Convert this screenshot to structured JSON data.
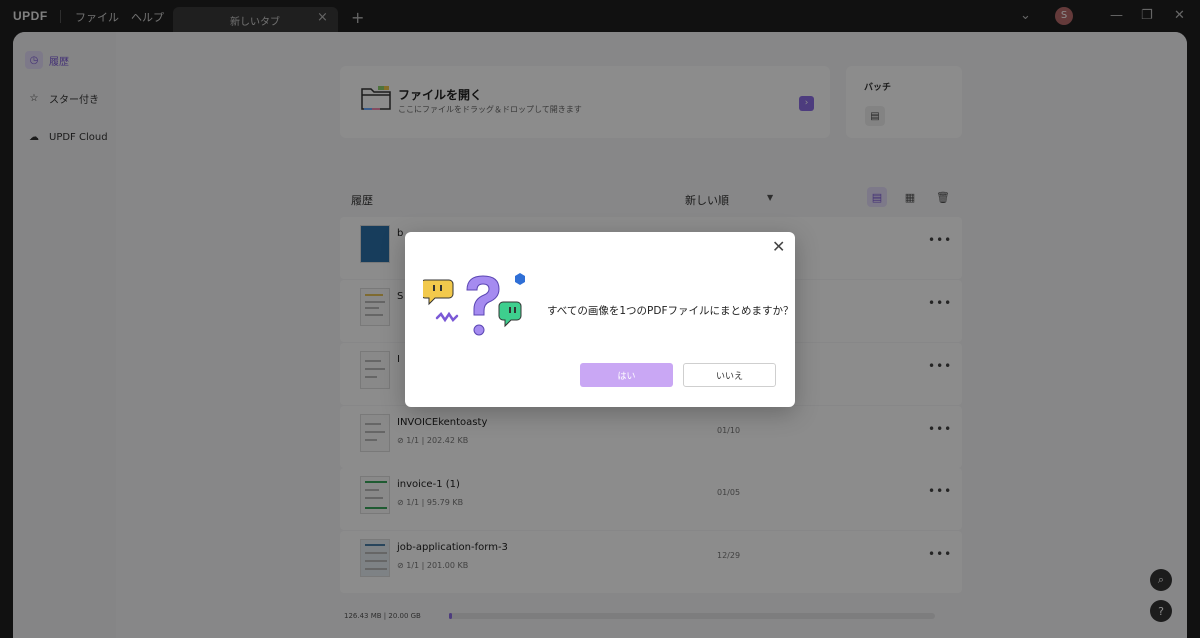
{
  "titlebar": {
    "logo": "UPDF",
    "menu": [
      "ファイル",
      "ヘルプ"
    ],
    "tab_label": "新しいタブ",
    "avatar_initial": "S"
  },
  "sidebar": {
    "items": [
      {
        "label": "履歴",
        "icon": "clock-icon",
        "active": true
      },
      {
        "label": "スター付き",
        "icon": "star-icon",
        "active": false
      },
      {
        "label": "UPDF Cloud",
        "icon": "cloud-icon",
        "active": false
      }
    ]
  },
  "open_card": {
    "title": "ファイルを開く",
    "subtitle": "ここにファイルをドラッグ＆ドロップして開きます"
  },
  "batch_card": {
    "title": "バッチ"
  },
  "history": {
    "title": "履歴",
    "sort_label": "新しい順",
    "files": [
      {
        "name": "b",
        "pages": "",
        "size": "",
        "date": ""
      },
      {
        "name": "S",
        "pages": "",
        "size": "",
        "date": ""
      },
      {
        "name": "I",
        "pages": "",
        "size": "",
        "date": ""
      },
      {
        "name": "INVOICEkentoasty",
        "pages": "1/1",
        "size": "202.42 KB",
        "date": "01/10"
      },
      {
        "name": "invoice-1 (1)",
        "pages": "1/1",
        "size": "95.79 KB",
        "date": "01/05"
      },
      {
        "name": "job-application-form-3",
        "pages": "1/1",
        "size": "201.00 KB",
        "date": "12/29"
      }
    ]
  },
  "storage": {
    "text": "126.43 MB | 20.00 GB",
    "used_fraction": 0.006
  },
  "dialog": {
    "message": "すべての画像を1つのPDFファイルにまとめますか？",
    "yes_label": "はい",
    "no_label": "いいえ"
  },
  "colors": {
    "accent": "#8d6ee6",
    "yes_button": "#c9a7f4"
  }
}
